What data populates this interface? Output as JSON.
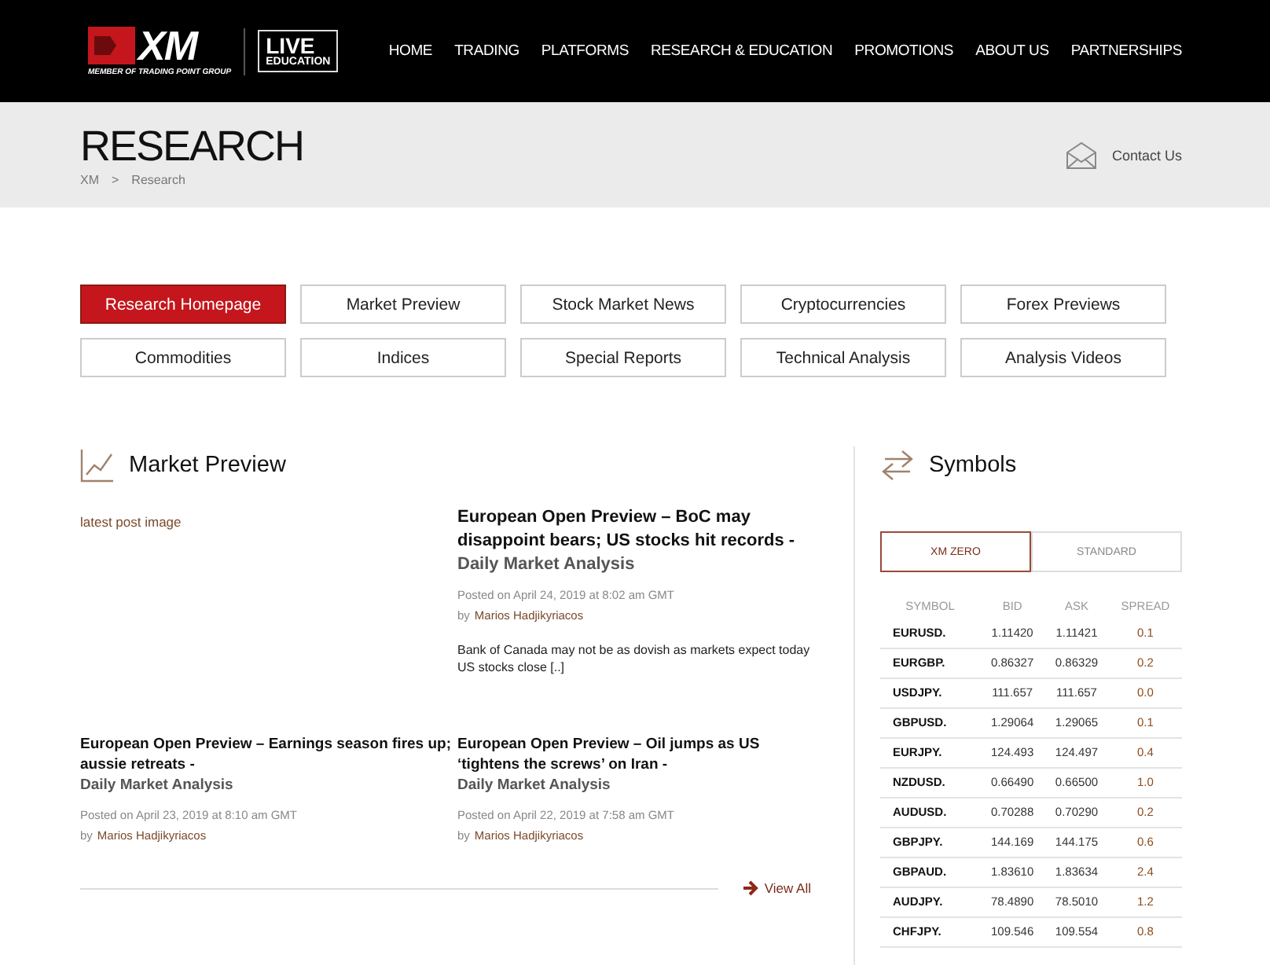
{
  "header": {
    "logo": {
      "brand": "XM",
      "tagline": "MEMBER OF TRADING POINT GROUP",
      "badge_line_1": "LIVE",
      "badge_line_2": "EDUCATION"
    },
    "nav": [
      {
        "label": "HOME"
      },
      {
        "label": "TRADING"
      },
      {
        "label": "PLATFORMS"
      },
      {
        "label": "RESEARCH & EDUCATION"
      },
      {
        "label": "PROMOTIONS"
      },
      {
        "label": "ABOUT US"
      },
      {
        "label": "PARTNERSHIPS"
      }
    ]
  },
  "page_header": {
    "title": "RESEARCH",
    "breadcrumb": [
      "XM",
      "Research"
    ],
    "breadcrumb_separator": ">",
    "contact": "Contact Us"
  },
  "categories": [
    {
      "label": "Research Homepage",
      "selected": true
    },
    {
      "label": "Market Preview",
      "selected": false
    },
    {
      "label": "Stock Market News",
      "selected": false
    },
    {
      "label": "Cryptocurrencies",
      "selected": false
    },
    {
      "label": "Forex Previews",
      "selected": false
    },
    {
      "label": "Commodities",
      "selected": false
    },
    {
      "label": "Indices",
      "selected": false
    },
    {
      "label": "Special Reports",
      "selected": false
    },
    {
      "label": "Technical Analysis",
      "selected": false
    },
    {
      "label": "Analysis Videos",
      "selected": false
    }
  ],
  "market_preview": {
    "title": "Market Preview",
    "image_alt": "latest post image",
    "view_all": "View All",
    "posts": [
      {
        "title": "European Open Preview – BoC may disappoint bears; US stocks hit records -",
        "subtitle": "Daily Market Analysis",
        "posted": "Posted on April 24, 2019 at 8:02 am GMT",
        "by": "by",
        "author": "Marios Hadjikyriacos",
        "excerpt": "Bank of Canada may not be as dovish as markets expect today US stocks close [..]"
      },
      {
        "title": "European Open Preview – Earnings season fires up; aussie retreats -",
        "subtitle": "Daily Market Analysis",
        "posted": "Posted on April 23, 2019 at 8:10 am GMT",
        "by": "by",
        "author": "Marios Hadjikyriacos"
      },
      {
        "title": "European Open Preview – Oil jumps as US ‘tightens the screws’ on Iran -",
        "subtitle": "Daily Market Analysis",
        "posted": "Posted on April 22, 2019 at 7:58 am GMT",
        "by": "by",
        "author": "Marios Hadjikyriacos"
      }
    ]
  },
  "symbols": {
    "title": "Symbols",
    "tabs": [
      {
        "label": "XM ZERO",
        "selected": true
      },
      {
        "label": "STANDARD",
        "selected": false
      }
    ],
    "columns": [
      "SYMBOL",
      "BID",
      "ASK",
      "SPREAD"
    ],
    "rows": [
      [
        "EURUSD.",
        "1.11420",
        "1.11421",
        "0.1"
      ],
      [
        "EURGBP.",
        "0.86327",
        "0.86329",
        "0.2"
      ],
      [
        "USDJPY.",
        "111.657",
        "111.657",
        "0.0"
      ],
      [
        "GBPUSD.",
        "1.29064",
        "1.29065",
        "0.1"
      ],
      [
        "EURJPY.",
        "124.493",
        "124.497",
        "0.4"
      ],
      [
        "NZDUSD.",
        "0.66490",
        "0.66500",
        "1.0"
      ],
      [
        "AUDUSD.",
        "0.70288",
        "0.70290",
        "0.2"
      ],
      [
        "GBPJPY.",
        "144.169",
        "144.175",
        "0.6"
      ],
      [
        "GBPAUD.",
        "1.83610",
        "1.83634",
        "2.4"
      ],
      [
        "AUDJPY.",
        "78.4890",
        "78.5010",
        "1.2"
      ],
      [
        "CHFJPY.",
        "109.546",
        "109.554",
        "0.8"
      ]
    ]
  }
}
